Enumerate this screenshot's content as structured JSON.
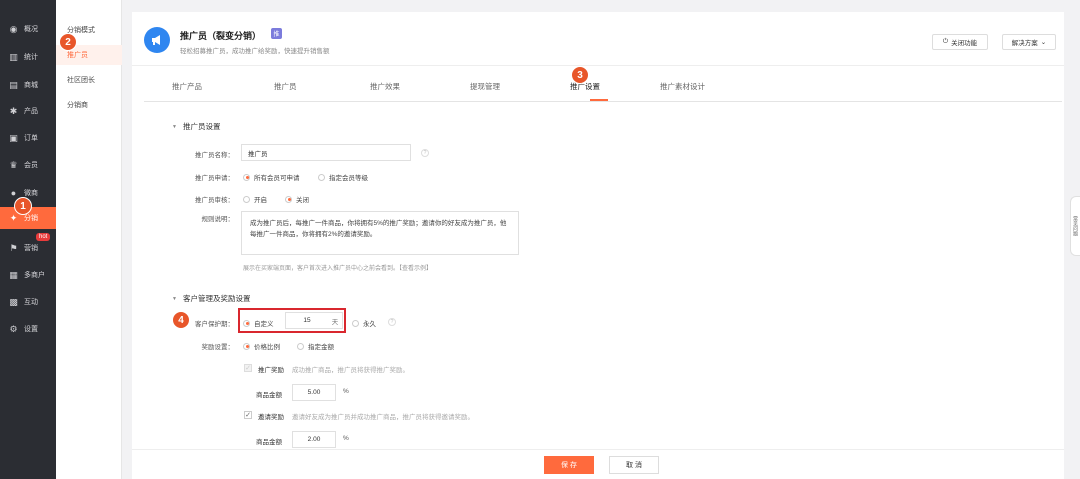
{
  "sidebar": {
    "items": [
      {
        "label": "概况",
        "icon": "dashboard-icon",
        "glyph": "◉"
      },
      {
        "label": "统计",
        "icon": "chart-icon",
        "glyph": "▥"
      },
      {
        "label": "商城",
        "icon": "store-icon",
        "glyph": "▤"
      },
      {
        "label": "产品",
        "icon": "product-icon",
        "glyph": "✱"
      },
      {
        "label": "订单",
        "icon": "order-icon",
        "glyph": "▣"
      },
      {
        "label": "会员",
        "icon": "member-icon",
        "glyph": "♛"
      },
      {
        "label": "微商",
        "icon": "wechat-icon",
        "glyph": "●"
      },
      {
        "label": "分销",
        "icon": "distribution-icon",
        "glyph": "✦"
      },
      {
        "label": "营销",
        "icon": "marketing-icon",
        "glyph": "⚑"
      },
      {
        "label": "多商户",
        "icon": "merchants-icon",
        "glyph": "▦"
      },
      {
        "label": "互动",
        "icon": "interaction-icon",
        "glyph": "▩"
      },
      {
        "label": "设置",
        "icon": "settings-icon",
        "glyph": "⚙"
      }
    ],
    "hot_badge": "hot"
  },
  "submenu": {
    "items": [
      "分销模式",
      "推广员",
      "社区团长",
      "分销商"
    ]
  },
  "markers": [
    "1",
    "2",
    "3",
    "4"
  ],
  "header": {
    "title": "推广员（裂变分销）",
    "tag": "推",
    "subtitle": "轻松招募推广员，成功推广给奖励，快速提升销售额",
    "close_btn": "关闭功能",
    "solution_btn": "解决方案"
  },
  "tabs": [
    "推广产品",
    "推广员",
    "推广效果",
    "提现管理",
    "推广设置",
    "推广素材设计"
  ],
  "promoter_settings": {
    "section_title": "推广员设置",
    "name_label": "推广员名称：",
    "name_value": "推广员",
    "apply_label": "推广员申请：",
    "apply_options": [
      "所有会员可申请",
      "指定会员等级"
    ],
    "review_label": "推广员审核：",
    "review_options": [
      "开启",
      "关闭"
    ],
    "rules_label": "规则说明：",
    "rules_text": "成为推广员后，每推广一件商品，你将拥有5%的推广奖励；邀请你的好友成为推广员，他每推广一件商品，你将拥有2%的邀请奖励。",
    "rules_hint": "展示在买家端页面，客户首次进入推广员中心之前会看到。【查看示例】"
  },
  "customer_settings": {
    "section_title": "客户管理及奖励设置",
    "protect_label": "客户保护期：",
    "protect_options": [
      "自定义",
      "永久"
    ],
    "protect_days": "15",
    "protect_unit": "天",
    "reward_label": "奖励设置：",
    "reward_options": [
      "价格比例",
      "指定金额"
    ],
    "promo_reward_label": "推广奖励",
    "promo_reward_desc": "成功推广商品，推广员将获得推广奖励。",
    "amount_label": "商品金额",
    "amount_value_1": "5.00",
    "percent": "%",
    "invite_reward_label": "邀请奖励",
    "invite_reward_desc": "邀请好友成为推广员并成功推广商品，推广员将获得邀请奖励。",
    "amount_value_2": "2.00"
  },
  "footer": {
    "save": "保 存",
    "cancel": "取 消"
  },
  "side_handle": "常见问题"
}
